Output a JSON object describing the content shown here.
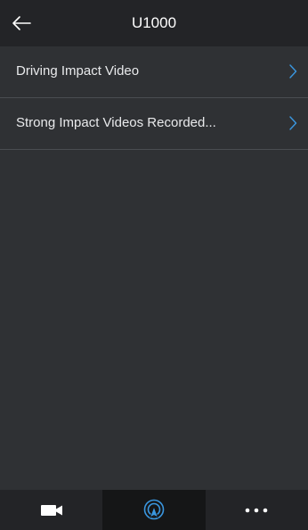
{
  "header": {
    "title": "U1000",
    "back_icon": "arrow-left-icon"
  },
  "menu": {
    "items": [
      {
        "label": "Driving Impact Video",
        "icon": "chevron-right-icon"
      },
      {
        "label": "Strong Impact Videos Recorded...",
        "icon": "chevron-right-icon"
      }
    ]
  },
  "tabbar": {
    "tabs": [
      {
        "icon": "video-camera-icon",
        "active": false
      },
      {
        "icon": "location-signal-icon",
        "active": true
      },
      {
        "icon": "more-dots-icon",
        "active": false
      }
    ]
  },
  "colors": {
    "accent": "#3a97e0",
    "header_bg": "#232427",
    "content_bg": "#2f3134",
    "divider": "#4a4d51",
    "active_tab_bg": "#151617"
  }
}
